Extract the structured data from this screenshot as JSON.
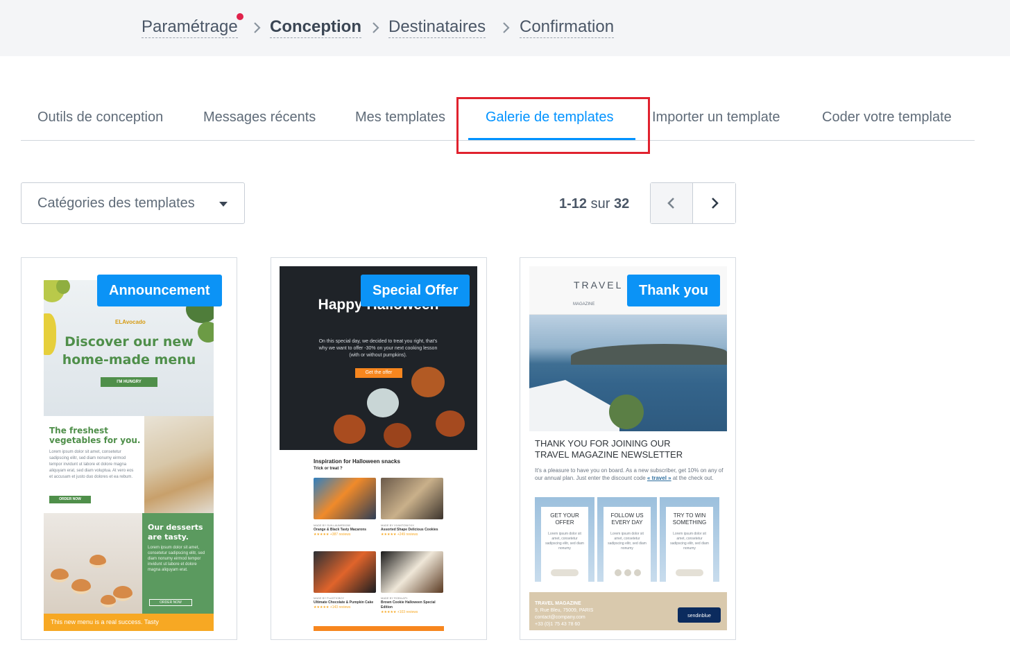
{
  "stepper": {
    "steps": [
      {
        "label": "Paramétrage"
      },
      {
        "label": "Conception"
      },
      {
        "label": "Destinataires"
      },
      {
        "label": "Confirmation"
      }
    ]
  },
  "tabs": [
    {
      "label": "Outils de conception"
    },
    {
      "label": "Messages récents"
    },
    {
      "label": "Mes templates"
    },
    {
      "label": "Galerie de templates"
    },
    {
      "label": "Importer un template"
    },
    {
      "label": "Coder votre template"
    }
  ],
  "active_tab": "Galerie de templates",
  "toolbar": {
    "category_select": "Catégories des templates",
    "pager": {
      "range": "1-12",
      "word": "sur",
      "total": "32"
    }
  },
  "cards": [
    {
      "badge": "Announcement",
      "thumb": {
        "brand": "ELAvocado",
        "title": "Discover our new home-made menu",
        "button": "I'M HUNGRY",
        "heading2": "The freshest vegetables for you.",
        "body2": "Lorem ipsum dolor sit amet, consetetur sadipscing elitr, sed diam nonumy eirmod tempor invidunt ut labore et dolore magna aliquyam erat, sed diam voluptua. At vero eos et accusam et justo duo dolores et ea rebum.",
        "button2": "ORDER NOW",
        "heading3": "Our desserts are tasty.",
        "body3": "Lorem ipsum dolor sit amet, consetetur sadipscing elitr, sed diam nonumy eirmod tempor invidunt ut labore et dolore magna aliquyam erat.",
        "button3": "ORDER NOW",
        "footer": "This new menu is a real success. Tasty"
      }
    },
    {
      "badge": "Special Offer",
      "thumb": {
        "title": "Happy Halloween",
        "body": "On this special day, we decided to treat you right, that's why we want to offer -30% on your next cooking lesson (with or without pumpkins).",
        "button": "Get the offer",
        "heading": "Inspiration for Halloween snacks",
        "sub": "Trick or treat ?",
        "recipes": [
          {
            "by": "MADE BY GUILLAUME59260",
            "name": "Orange & Black Tasty Macarons",
            "reviews": "★★★★★ +387 reviews"
          },
          {
            "by": "MADE BY XXANTONIOXX",
            "name": "Assorted Shape Delicious Cookies",
            "reviews": "★★★★★ +249 reviews"
          },
          {
            "by": "MADE BY PLASTICBOY",
            "name": "Ultimate Chocolate & Pumpkin Cake",
            "reviews": "★★★★★ +143 reviews"
          },
          {
            "by": "MADE BY ROBILAP1",
            "name": "Brown Cookie Halloween Special Edition",
            "reviews": "★★★★★ +103 reviews"
          }
        ]
      }
    },
    {
      "badge": "Thank you",
      "thumb": {
        "brand": "TRAVEL M",
        "nav": "MAGAZINE",
        "heading": "THANK YOU FOR JOINING OUR TRAVEL MAGAZINE NEWSLETTER",
        "body": "It's a pleasure to have you on board. As a new subscriber, get 10% on any of our annual plan. Just enter the discount code",
        "code": "« travel »",
        "body_end": "at the check out.",
        "boxes": [
          {
            "title": "GET YOUR OFFER",
            "body": "Lorem ipsum dolor sit amet, consetetur sadipscing elitr, sed diam nonumy"
          },
          {
            "title": "FOLLOW US EVERY DAY",
            "body": "Lorem ipsum dolor sit amet, consetetur sadipscing elitr, sed diam nonumy"
          },
          {
            "title": "TRY TO WIN SOMETHING",
            "body": "Lorem ipsum dolor sit amet, consetetur sadipscing elitr, sed diam nonumy"
          }
        ],
        "footer_name": "TRAVEL MAGAZINE",
        "footer_address": "9, Rue Bleu, 75009, PARIS",
        "footer_email": "contact@company.com",
        "footer_phone": "+33 (0)1 75 43 78 60",
        "sender": "sendinblue"
      }
    }
  ],
  "colors": {
    "accent": "#0092ff",
    "badge": "#0b93f6",
    "highlight": "#e0222e",
    "notification_dot": "#e0224b"
  }
}
